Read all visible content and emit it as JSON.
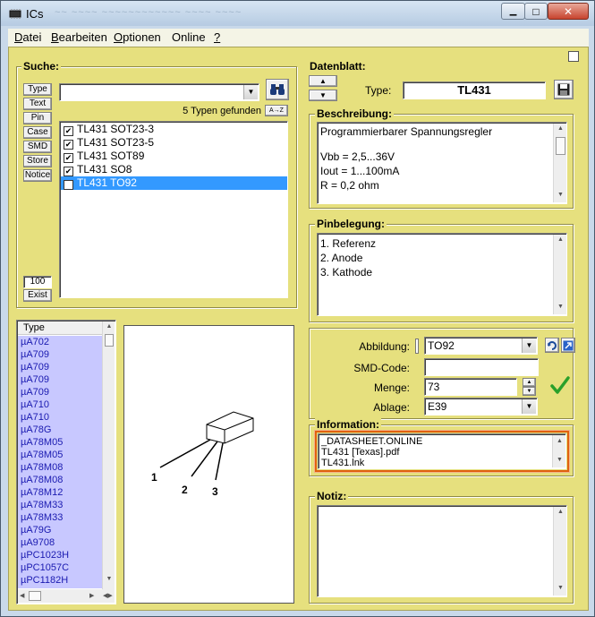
{
  "window": {
    "title": "ICs",
    "title_ghost": "~~ ~~~~ ~~~~~~~~~~~~ ~~~~ ~~~~",
    "minimize_glyph": "▁",
    "maximize_glyph": "□",
    "close_glyph": "✕"
  },
  "menu": {
    "items": [
      {
        "label": "Datei",
        "accel": "D",
        "rest": "atei"
      },
      {
        "label": "Bearbeiten",
        "accel": "B",
        "rest": "earbeiten"
      },
      {
        "label": "Optionen",
        "accel": "O",
        "rest": "ptionen"
      },
      {
        "label": "Online",
        "accel": "",
        "rest": "Online"
      },
      {
        "label": "?",
        "accel": "?",
        "rest": ""
      }
    ]
  },
  "search": {
    "title": "Suche:",
    "filter_buttons": [
      "Type",
      "Text",
      "Pin",
      "Case",
      "SMD",
      "Store",
      "Notice"
    ],
    "input_value": "",
    "result_text": "5 Typen gefunden",
    "sort_label": "A→Z",
    "results": [
      {
        "label": "TL431 SOT23-3",
        "checked": true,
        "selected": false
      },
      {
        "label": "TL431 SOT23-5",
        "checked": true,
        "selected": false
      },
      {
        "label": "TL431 SOT89",
        "checked": true,
        "selected": false
      },
      {
        "label": "TL431 SO8",
        "checked": true,
        "selected": false
      },
      {
        "label": "TL431 TO92",
        "checked": true,
        "selected": true
      }
    ],
    "count_value": "100",
    "exist_label": "Exist"
  },
  "typelist": {
    "header": "Type",
    "items": [
      "µA702",
      "µA709",
      "µA709",
      "µA709",
      "µA709",
      "µA710",
      "µA710",
      "µA78G",
      "µA78M05",
      "µA78M05",
      "µA78M08",
      "µA78M08",
      "µA78M12",
      "µA78M33",
      "µA78M33",
      "µA79G",
      "µA9708",
      "µPC1023H",
      "µPC1057C",
      "µPC1182H"
    ]
  },
  "package": {
    "pins": [
      "1",
      "2",
      "3"
    ]
  },
  "datasheet": {
    "title": "Datenblatt:",
    "type_label": "Type:",
    "type_value": "TL431",
    "up_glyph": "▲",
    "down_glyph": "▼"
  },
  "description": {
    "title": "Beschreibung:",
    "lines": [
      "Programmierbarer Spannungsregler",
      "",
      "Vbb = 2,5...36V",
      "Iout = 1...100mA",
      "R = 0,2 ohm"
    ]
  },
  "pinout": {
    "title": "Pinbelegung:",
    "lines": [
      "1. Referenz",
      "2. Anode",
      "3. Kathode"
    ]
  },
  "details": {
    "abbildung_label": "Abbildung:",
    "abbildung_value": "TO92",
    "smd_label": "SMD-Code:",
    "smd_value": "",
    "menge_label": "Menge:",
    "menge_value": "73",
    "ablage_label": "Ablage:",
    "ablage_value": "E39"
  },
  "information": {
    "title": "Information:",
    "lines": [
      "_DATASHEET.ONLINE",
      "TL431 [Texas].pdf",
      "TL431.lnk"
    ]
  },
  "notes": {
    "title": "Notiz:",
    "value": ""
  },
  "colors": {
    "panel": "#e6e07e",
    "list_highlight": "#c8c8ff",
    "selection": "#3399ff",
    "info_border": "#e06010"
  }
}
